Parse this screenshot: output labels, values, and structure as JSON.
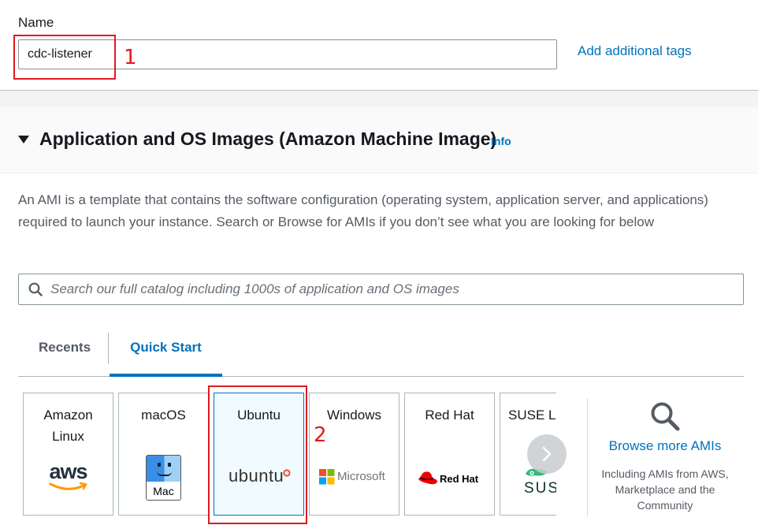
{
  "name_field": {
    "label": "Name",
    "value": "cdc-listener",
    "add_tags_link": "Add additional tags"
  },
  "annotations": [
    "1",
    "2"
  ],
  "section": {
    "title": "Application and OS Images (Amazon Machine Image)",
    "info_link": "Info",
    "description": "An AMI is a template that contains the software configuration (operating system, application server, and applications) required to launch your instance. Search or Browse for AMIs if you don’t see what you are looking for below"
  },
  "search": {
    "placeholder": "Search our full catalog including 1000s of application and OS images",
    "icon": "search-icon"
  },
  "tabs": [
    {
      "label": "Recents",
      "active": false
    },
    {
      "label": "Quick Start",
      "active": true
    }
  ],
  "ami_cards": [
    {
      "title": "Amazon Linux",
      "logo_text": "aws",
      "icon": "aws-logo",
      "selected": false
    },
    {
      "title": "macOS",
      "logo_text": "Mac",
      "icon": "finder-icon",
      "selected": false
    },
    {
      "title": "Ubuntu",
      "logo_text": "ubuntu",
      "icon": "ubuntu-logo",
      "selected": true
    },
    {
      "title": "Windows",
      "logo_text": "Microsoft",
      "icon": "microsoft-logo",
      "selected": false
    },
    {
      "title": "Red Hat",
      "logo_text": "Red Hat",
      "icon": "redhat-logo",
      "selected": false
    },
    {
      "title": "SUSE Li",
      "logo_text": "SUSI",
      "icon": "suse-logo",
      "selected": false
    }
  ],
  "browse": {
    "link": "Browse more AMIs",
    "description": "Including AMIs from AWS, Marketplace and the Community"
  },
  "colors": {
    "link": "#0073bb",
    "annotation": "#e0191f",
    "aws_orange": "#ff9900",
    "ubuntu_orange": "#e95420",
    "redhat_red": "#ee0000",
    "suse_green": "#30ba78"
  }
}
